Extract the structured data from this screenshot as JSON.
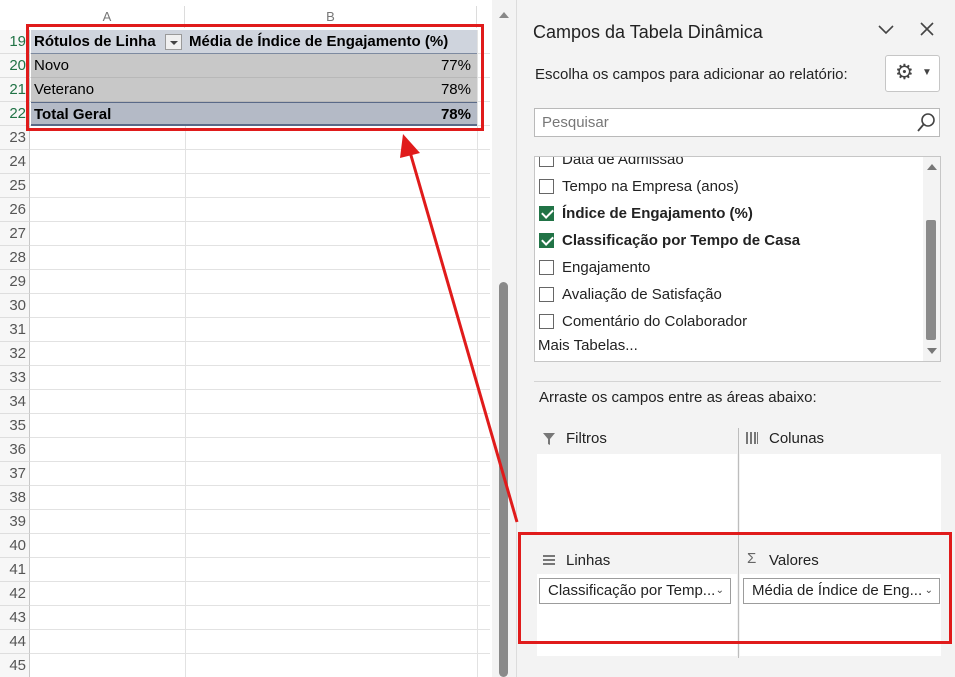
{
  "sheet": {
    "columns": [
      "A",
      "B"
    ],
    "rows": [
      "19",
      "20",
      "21",
      "22",
      "23",
      "24",
      "25",
      "26",
      "27",
      "28",
      "29",
      "30",
      "31",
      "32",
      "33",
      "34",
      "35",
      "36",
      "37",
      "38",
      "39",
      "40",
      "41",
      "42",
      "43",
      "44",
      "45"
    ],
    "pivot": {
      "header": {
        "row_label": "Rótulos de Linha",
        "value_label": "Média de Índice de Engajamento (%)"
      },
      "data": [
        {
          "label": "Novo",
          "value": "77%"
        },
        {
          "label": "Veterano",
          "value": "78%"
        }
      ],
      "total": {
        "label": "Total Geral",
        "value": "78%"
      }
    }
  },
  "pane": {
    "title": "Campos da Tabela Dinâmica",
    "collapse_icon": "chevron-down-icon",
    "close_icon": "close-icon",
    "choose_label": "Escolha os campos para adicionar ao relatório:",
    "settings_icon": "gear-icon",
    "search_placeholder": "Pesquisar",
    "fields": [
      {
        "label": "Data de Admissão",
        "checked": false
      },
      {
        "label": "Tempo na Empresa (anos)",
        "checked": false
      },
      {
        "label": "Índice de Engajamento (%)",
        "checked": true
      },
      {
        "label": "Classificação por Tempo de Casa",
        "checked": true
      },
      {
        "label": "Engajamento",
        "checked": false
      },
      {
        "label": "Avaliação de Satisfação",
        "checked": false
      },
      {
        "label": "Comentário do Colaborador",
        "checked": false
      }
    ],
    "more_tables": "Mais Tabelas...",
    "drag_label": "Arraste os campos entre as áreas abaixo:",
    "areas": {
      "filters": {
        "label": "Filtros"
      },
      "columns": {
        "label": "Colunas"
      },
      "rows": {
        "label": "Linhas",
        "chip": "Classificação por Temp..."
      },
      "values": {
        "label": "Valores",
        "chip": "Média de Índice de Eng..."
      }
    }
  },
  "colors": {
    "annotation": "#e01b1b",
    "excel_green": "#217346"
  }
}
